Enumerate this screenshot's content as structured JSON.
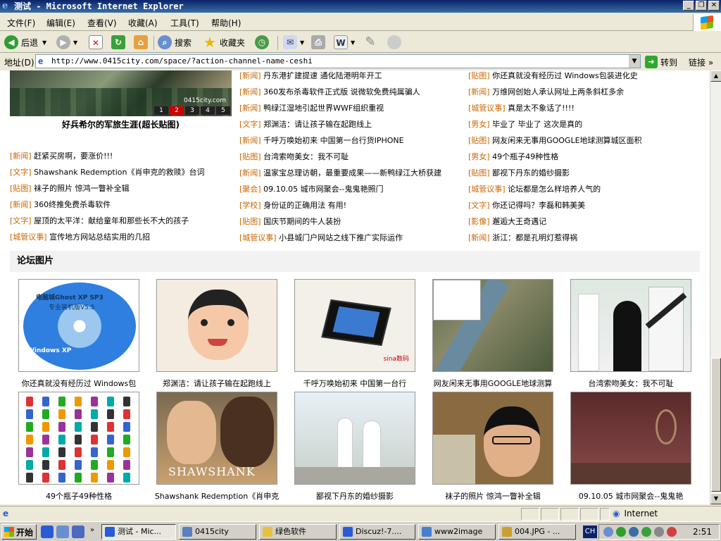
{
  "window": {
    "title": "测试 - Microsoft Internet Explorer",
    "icon": "ie-icon"
  },
  "menu": [
    "文件(F)",
    "编辑(E)",
    "查看(V)",
    "收藏(A)",
    "工具(T)",
    "帮助(H)"
  ],
  "toolbar": {
    "back": "后退",
    "search": "搜索",
    "favorites": "收藏夹"
  },
  "address": {
    "label": "地址(D)",
    "url": "http://www.0415city.com/space/?action-channel-name-ceshi",
    "go": "转到",
    "links": "链接"
  },
  "hero": {
    "caption": "好兵希尔的军旅生涯(超长贴图)",
    "watermark": "0415city.com",
    "pager": [
      "1",
      "2",
      "3",
      "4",
      "5"
    ],
    "active_page": 2
  },
  "news_col2": [
    {
      "cat": "[新闻]",
      "title": "丹东港扩建提速 通化陆港明年开工"
    },
    {
      "cat": "[新闻]",
      "title": "360发布杀毒软件正式版 说微软免费纯属骗人"
    },
    {
      "cat": "[新闻]",
      "title": "鸭绿江湿地引起世界WWF组织重视"
    },
    {
      "cat": "[文字]",
      "title": "郑渊洁：请让孩子输在起跑线上"
    },
    {
      "cat": "[新闻]",
      "title": "千呼万唤始初来 中国第一台行货IPHONE"
    },
    {
      "cat": "[贴图]",
      "title": "台湾索吻美女：我不可耻"
    },
    {
      "cat": "[新闻]",
      "title": "温家宝总理访朝，最重要成果——新鸭绿江大桥获建"
    },
    {
      "cat": "[聚会]",
      "title": "09.10.05 城市网聚会--鬼鬼艳照门"
    },
    {
      "cat": "[学校]",
      "title": "身份证的正确用法  有用!"
    },
    {
      "cat": "[贴图]",
      "title": "国庆节期间的牛人装扮"
    },
    {
      "cat": "[城管议事]",
      "title": "小县城门户网站之线下推广实际运作"
    }
  ],
  "news_col3": [
    {
      "cat": "[贴图]",
      "title": "你还真就没有经历过 Windows包装进化史"
    },
    {
      "cat": "[新闻]",
      "title": "万维网创始人承认网址上两条斜杠多余"
    },
    {
      "cat": "[城管议事]",
      "title": "真是太不象话了!!!!"
    },
    {
      "cat": "[男女]",
      "title": "毕业了  毕业了  这次是真的"
    },
    {
      "cat": "[贴图]",
      "title": "网友闲来无事用GOOGLE地球测算城区面积"
    },
    {
      "cat": "[男女]",
      "title": "49个瓶子49种性格"
    },
    {
      "cat": "[贴图]",
      "title": "鄙视下丹东的婚纱摄影"
    },
    {
      "cat": "[城管议事]",
      "title": "论坛都是怎么样培养人气的"
    },
    {
      "cat": "[文字]",
      "title": "你还记得吗？李磊和韩美美"
    },
    {
      "cat": "[影像]",
      "title": "邂逅大王奇遇记"
    },
    {
      "cat": "[新闻]",
      "title": "浙江：都是孔明灯惹得祸"
    }
  ],
  "news_col1": [
    {
      "cat": "[新闻]",
      "title": "赶紧买房啊，要涨价!!!"
    },
    {
      "cat": "[文字]",
      "title": "Shawshank Redemption《肖申克的救赎》台词"
    },
    {
      "cat": "[贴图]",
      "title": "袜子的照片 惊鸿一瞥补全辑"
    },
    {
      "cat": "[新闻]",
      "title": "360终推免费杀毒软件"
    },
    {
      "cat": "[文字]",
      "title": "屋顶的太平洋：献给童年和那些长不大的孩子"
    },
    {
      "cat": "[城管议事]",
      "title": "宣传地方网站总结实用的几招"
    }
  ],
  "section": {
    "title": "论坛图片"
  },
  "gallery": [
    {
      "caption": "你还真就没有经历过 Windows包",
      "kind": "cd"
    },
    {
      "caption": "郑渊洁：请让孩子输在起跑线上",
      "kind": "child"
    },
    {
      "caption": "千呼万唤始初来 中国第一台行",
      "kind": "iphone"
    },
    {
      "caption": "网友闲来无事用GOOGLE地球测算",
      "kind": "map"
    },
    {
      "caption": "台湾索吻美女：我不可耻",
      "kind": "soldiers"
    },
    {
      "caption": "49个瓶子49种性格",
      "kind": "bottles"
    },
    {
      "caption": "Shawshank Redemption《肖申克",
      "kind": "movie"
    },
    {
      "caption": "鄙视下丹东的婚纱摄影",
      "kind": "wedding"
    },
    {
      "caption": "袜子的照片 惊鸿一瞥补全辑",
      "kind": "man"
    },
    {
      "caption": "09.10.05 城市网聚会--鬼鬼艳",
      "kind": "room"
    }
  ],
  "gallery_texts": {
    "cd_title": "电脑城Ghost XP SP3",
    "cd_sub": "专业装机版V5.5",
    "cd_logo": "Windows XP",
    "iphone_brand": "sina数码",
    "movie_title": "SHAWSHANK"
  },
  "status": {
    "zone": "Internet"
  },
  "taskbar": {
    "start": "开始",
    "tasks": [
      "测试 - Mic...",
      "0415city",
      "绿色软件",
      "Discuz!-7....",
      "www2image",
      "004.JPG - ..."
    ],
    "lang": "CH",
    "clock": "2:51"
  }
}
